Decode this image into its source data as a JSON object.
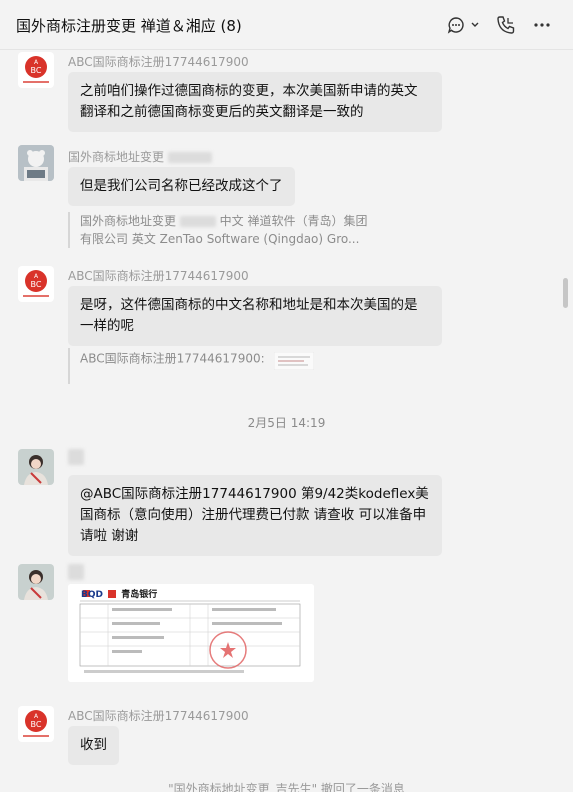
{
  "header": {
    "title": "国外商标注册变更 禅道＆湘应 (8)"
  },
  "messages": [
    {
      "sender": "ABC国际商标注册17744617900",
      "text": "之前咱们操作过德国商标的变更，本次美国新申请的英文翻译和之前德国商标变更后的英文翻译是一致的"
    },
    {
      "sender": "国外商标地址变更",
      "text": "但是我们公司名称已经改成这个了",
      "quote_prefix": "国外商标地址变更",
      "quote_text": "中文 禅道软件（青岛）集团有限公司  英文 ZenTao Software (Qingdao) Gro..."
    },
    {
      "sender": "ABC国际商标注册17744617900",
      "text": "是呀，这件德国商标的中文名称和地址是和本次美国的是一样的呢",
      "quote_prefix": "ABC国际商标注册17744617900:"
    },
    {
      "sender": "ABC国际商标注册17744617900",
      "text": "收到"
    }
  ],
  "time_separator": "2月5日 14:19",
  "mention_message": {
    "text": "@ABC国际商标注册17744617900 第9/42类kodeflex美国商标（意向使用）注册代理费已付款 请查收 可以准备申请啦 谢谢"
  },
  "receipt": {
    "bank_code": "BQD",
    "bank_name": "青岛银行"
  },
  "system_note": "\"国外商标地址变更_吉先生\" 撤回了一条消息",
  "colors": {
    "bubble": "#e8e8e8",
    "background": "#f3f3f3",
    "logo_red": "#d9332a"
  }
}
